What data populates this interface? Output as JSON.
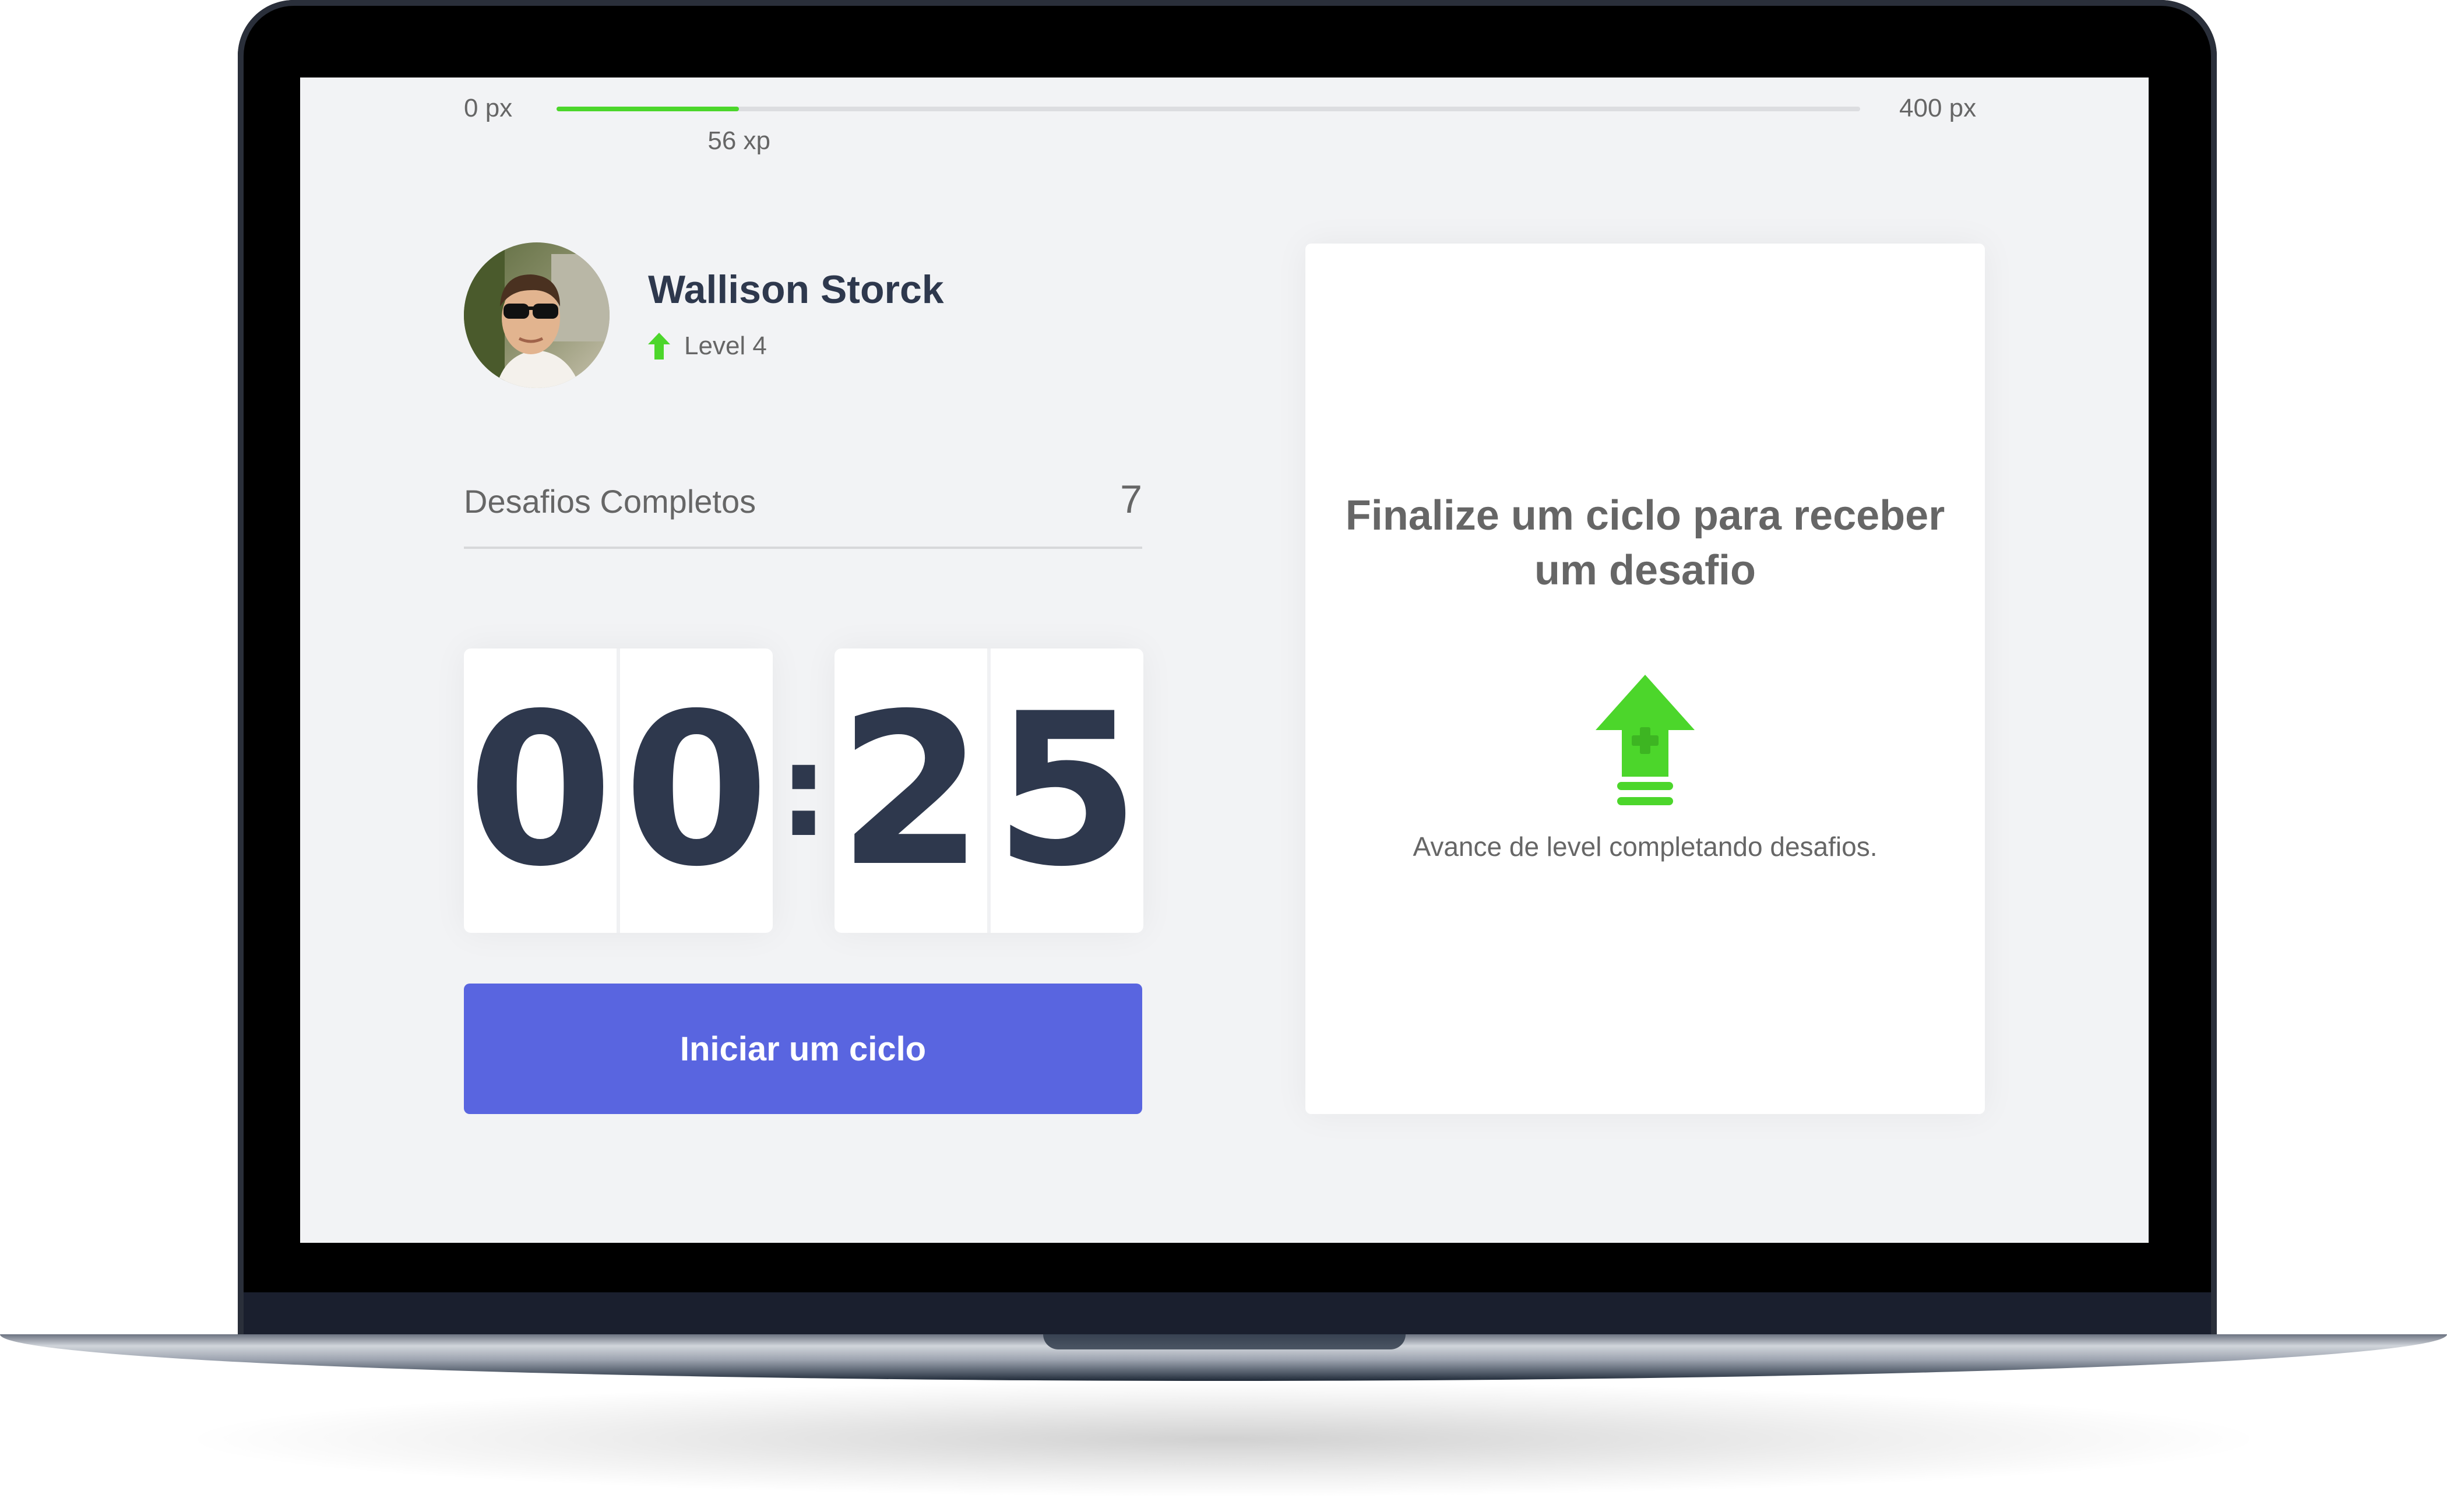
{
  "xp_bar": {
    "min_label": "0 px",
    "max_label": "400 px",
    "current_label": "56 xp",
    "current_xp": 56,
    "max_xp": 400,
    "fill_color": "#4cd62b"
  },
  "profile": {
    "name": "Wallison Storck",
    "level_label": "Level 4",
    "level_icon": "level-arrow-up-icon"
  },
  "completed_challenges": {
    "label": "Desafios Completos",
    "count": "7"
  },
  "countdown": {
    "minute_left": "0",
    "minute_right": "0",
    "separator": ":",
    "second_left": "2",
    "second_right": "5"
  },
  "start_button": {
    "label": "Iniciar um ciclo",
    "color": "#5965e0"
  },
  "challenge_box": {
    "title": "Finalize um ciclo para receber um desafio",
    "icon": "level-up-icon",
    "hint": "Avance de level completando desafios."
  },
  "colors": {
    "background": "#f2f3f5",
    "text": "#666666",
    "title": "#2e384d",
    "green": "#4cd62b"
  }
}
